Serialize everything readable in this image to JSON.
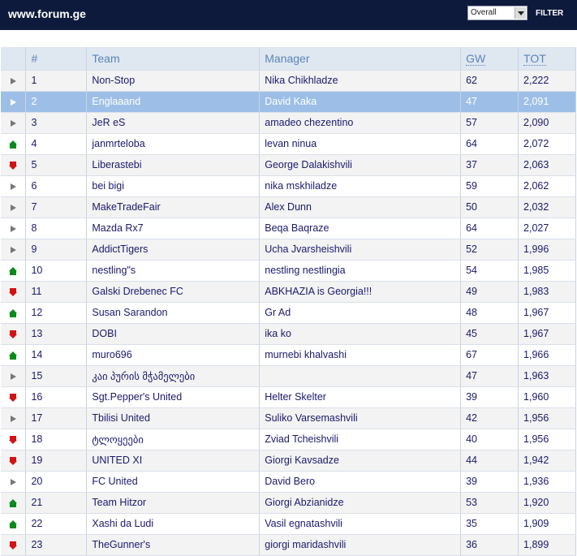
{
  "header": {
    "site_title": "www.forum.ge",
    "filter_select_value": "Overall",
    "filter_button_label": "FILTER"
  },
  "table": {
    "columns": {
      "movement": "",
      "rank": "#",
      "team": "Team",
      "manager": "Manager",
      "gw": "GW",
      "tot": "TOT"
    },
    "rows": [
      {
        "movement": "same",
        "rank": "1",
        "team": "Non-Stop",
        "manager": "Nika Chikhladze",
        "gw": "62",
        "tot": "2,222"
      },
      {
        "movement": "same",
        "rank": "2",
        "team": "Englaaand",
        "manager": "David Kaka",
        "gw": "47",
        "tot": "2,091",
        "selected": true
      },
      {
        "movement": "same",
        "rank": "3",
        "team": "JeR eS",
        "manager": "amadeo chezentino",
        "gw": "57",
        "tot": "2,090"
      },
      {
        "movement": "up",
        "rank": "4",
        "team": "janmrteloba",
        "manager": "levan ninua",
        "gw": "64",
        "tot": "2,072"
      },
      {
        "movement": "down",
        "rank": "5",
        "team": "Liberastebi",
        "manager": "George Dalakishvili",
        "gw": "37",
        "tot": "2,063"
      },
      {
        "movement": "same",
        "rank": "6",
        "team": "bei bigi",
        "manager": "nika mskhiladze",
        "gw": "59",
        "tot": "2,062"
      },
      {
        "movement": "same",
        "rank": "7",
        "team": "MakeTradeFair",
        "manager": "Alex Dunn",
        "gw": "50",
        "tot": "2,032"
      },
      {
        "movement": "same",
        "rank": "8",
        "team": "Mazda Rx7",
        "manager": "Beqa Baqraze",
        "gw": "64",
        "tot": "2,027"
      },
      {
        "movement": "same",
        "rank": "9",
        "team": "AddictTigers",
        "manager": "Ucha Jvarsheishvili",
        "gw": "52",
        "tot": "1,996"
      },
      {
        "movement": "up",
        "rank": "10",
        "team": "nestling\"s",
        "manager": "nestling nestlingia",
        "gw": "54",
        "tot": "1,985"
      },
      {
        "movement": "down",
        "rank": "11",
        "team": "Galski Drebenec FC",
        "manager": "ABKHAZIA is Georgia!!!",
        "gw": "49",
        "tot": "1,983"
      },
      {
        "movement": "up",
        "rank": "12",
        "team": "Susan Sarandon",
        "manager": "Gr Ad",
        "gw": "48",
        "tot": "1,967"
      },
      {
        "movement": "down",
        "rank": "13",
        "team": "DOBI",
        "manager": "ika ko",
        "gw": "45",
        "tot": "1,967"
      },
      {
        "movement": "up",
        "rank": "14",
        "team": "muro696",
        "manager": "murnebi khalvashi",
        "gw": "67",
        "tot": "1,966"
      },
      {
        "movement": "same",
        "rank": "15",
        "team": "კაი პურის მჭამელები",
        "manager": "",
        "gw": "47",
        "tot": "1,963"
      },
      {
        "movement": "down",
        "rank": "16",
        "team": "Sgt.Pepper's United",
        "manager": "Helter Skelter",
        "gw": "39",
        "tot": "1,960"
      },
      {
        "movement": "same",
        "rank": "17",
        "team": "Tbilisi United",
        "manager": "Suliko Varsemashvili",
        "gw": "42",
        "tot": "1,956"
      },
      {
        "movement": "down",
        "rank": "18",
        "team": "ტლოყეები",
        "manager": "Zviad Tcheishvili",
        "gw": "40",
        "tot": "1,956"
      },
      {
        "movement": "down",
        "rank": "19",
        "team": "UNITED XI",
        "manager": "Giorgi Kavsadze",
        "gw": "44",
        "tot": "1,942"
      },
      {
        "movement": "same",
        "rank": "20",
        "team": "FC United",
        "manager": "David Bero",
        "gw": "39",
        "tot": "1,936"
      },
      {
        "movement": "up",
        "rank": "21",
        "team": "Team Hitzor",
        "manager": "Giorgi Abzianidze",
        "gw": "53",
        "tot": "1,920"
      },
      {
        "movement": "up",
        "rank": "22",
        "team": "Xashi da Ludi",
        "manager": "Vasil egnatashvili",
        "gw": "35",
        "tot": "1,909"
      },
      {
        "movement": "down",
        "rank": "23",
        "team": "TheGunner's",
        "manager": "giorgi maridashvili",
        "gw": "36",
        "tot": "1,899"
      }
    ]
  },
  "colors": {
    "header_bar": "#0e1a3c",
    "selected_row": "#9dbfe7",
    "column_header_bg": "#dfe7f1",
    "up_icon": "#0a8a1c",
    "down_icon": "#d01313",
    "same_icon": "#777777"
  }
}
